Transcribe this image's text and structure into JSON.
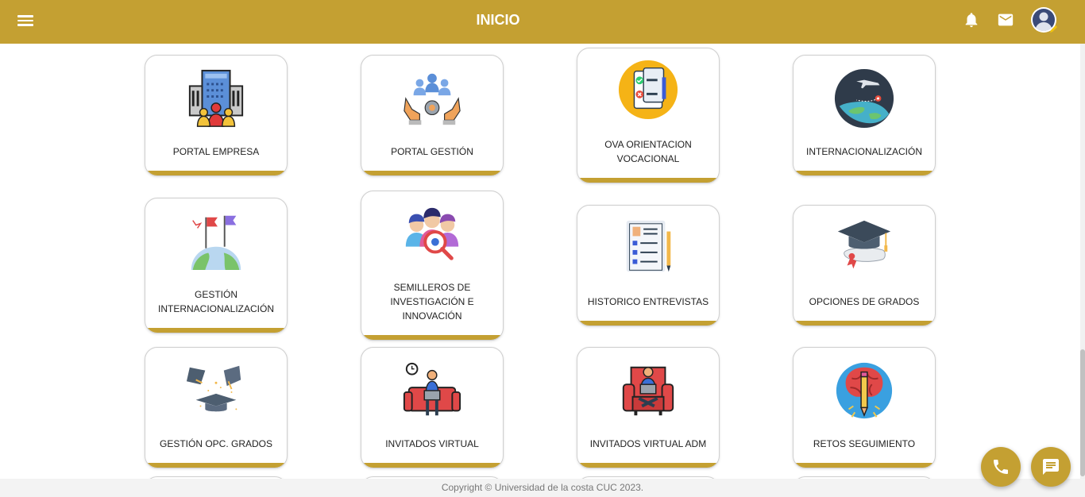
{
  "header": {
    "title": "INICIO",
    "menu_icon": "menu-icon",
    "notification_icon": "bell-icon",
    "mail_icon": "mail-icon",
    "avatar_icon": "user-avatar"
  },
  "cards": [
    {
      "label": "PORTAL EMPRESA",
      "icon": "company-buildings-icon"
    },
    {
      "label": "PORTAL GESTIÓN",
      "icon": "management-team-icon"
    },
    {
      "label": "OVA ORIENTACION VOCACIONAL",
      "icon": "checklist-icon"
    },
    {
      "label": "INTERNACIONALIZACIÓN",
      "icon": "globe-plane-icon"
    },
    {
      "label": "GESTIÓN INTERNACIONALIZACIÓN",
      "icon": "flags-globe-icon"
    },
    {
      "label": "SEMILLEROS DE INVESTIGACIÓN E INNOVACIÓN",
      "icon": "research-team-icon"
    },
    {
      "label": "HISTORICO ENTREVISTAS",
      "icon": "document-list-icon"
    },
    {
      "label": "OPCIONES DE GRADOS",
      "icon": "graduation-cap-icon"
    },
    {
      "label": "GESTIÓN OPC. GRADOS",
      "icon": "graduation-caps-icon"
    },
    {
      "label": "INVITADOS VIRTUAL",
      "icon": "person-sofa-laptop-icon"
    },
    {
      "label": "INVITADOS VIRTUAL ADM",
      "icon": "person-armchair-laptop-icon"
    },
    {
      "label": "RETOS SEGUIMIENTO",
      "icon": "brain-pencil-icon"
    }
  ],
  "footer": {
    "text": "Copyright © Universidad de la costa CUC 2023."
  },
  "fabs": {
    "phone_icon": "phone-icon",
    "chat_icon": "chat-icon"
  },
  "colors": {
    "primary": "#c4a032",
    "footer_bg": "#f3f3f3"
  }
}
